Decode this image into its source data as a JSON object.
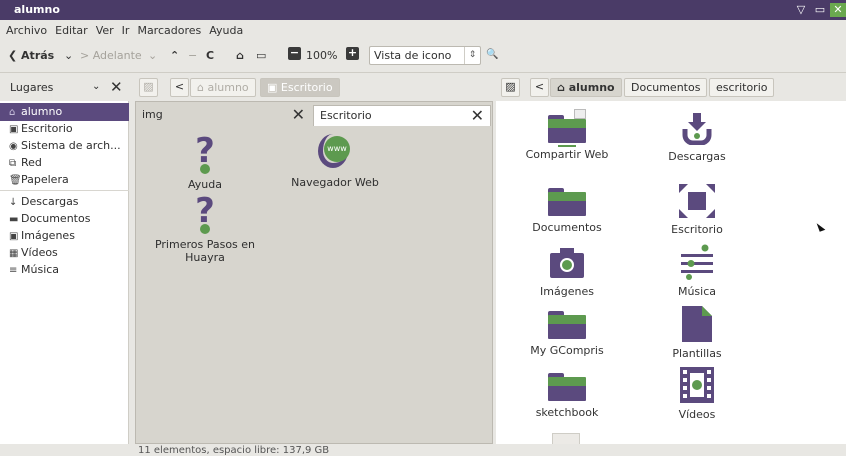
{
  "window": {
    "title": "alumno"
  },
  "menu": [
    "Archivo",
    "Editar",
    "Ver",
    "Ir",
    "Marcadores",
    "Ayuda"
  ],
  "toolbar": {
    "back": "❮ Atrás",
    "back_arrow": "⌄",
    "forward": "> Adelante",
    "forward_arrow": "⌄",
    "up": "⌃",
    "down": "−",
    "reload": "C",
    "home": "⌂",
    "computer": "▭",
    "zoom_out": "−",
    "zoom_level": "100%",
    "zoom_in": "+",
    "view_mode": "Vista de icono",
    "view_arrows": "⇕",
    "search": "🔍"
  },
  "sidebar": {
    "header": "Lugares",
    "header_chevron": "⌄",
    "close": "✕",
    "items": [
      {
        "label": "alumno",
        "icon": "⌂"
      },
      {
        "label": "Escritorio",
        "icon": "▣"
      },
      {
        "label": "Sistema de arch...",
        "icon": "◉"
      },
      {
        "label": "Red",
        "icon": "⧉"
      },
      {
        "label": "Papelera",
        "icon": "🗑"
      },
      {
        "label": "Descargas",
        "icon": "↓"
      },
      {
        "label": "Documentos",
        "icon": "▬"
      },
      {
        "label": "Imágenes",
        "icon": "▣"
      },
      {
        "label": "Vídeos",
        "icon": "▦"
      },
      {
        "label": "Música",
        "icon": "≡"
      }
    ]
  },
  "left_pane": {
    "path": {
      "toggle": "▨",
      "back": "<",
      "home_crumb": "⌂ alumno",
      "current": "▣ Escritorio"
    },
    "tabs": [
      {
        "label": "img",
        "close": "✕"
      },
      {
        "label": "Escritorio",
        "close": "✕"
      }
    ],
    "items": [
      {
        "label": "Ayuda",
        "icon": "?"
      },
      {
        "label": "Navegador Web",
        "icon": "www"
      },
      {
        "label": "Primeros Pasos en\nHuayra",
        "icon": "?"
      }
    ]
  },
  "right_pane": {
    "path": {
      "toggle": "▨",
      "back": "<",
      "home_crumb": "⌂ alumno",
      "c2": "Documentos",
      "c3": "escritorio"
    },
    "items": [
      {
        "label": "Compartir Web"
      },
      {
        "label": "Descargas"
      },
      {
        "label": "Documentos"
      },
      {
        "label": "Escritorio"
      },
      {
        "label": "Imágenes"
      },
      {
        "label": "Música"
      },
      {
        "label": "My GCompris"
      },
      {
        "label": "Plantillas"
      },
      {
        "label": "sketchbook"
      },
      {
        "label": "Vídeos"
      }
    ]
  },
  "statusbar": "11 elementos, espacio libre: 137,9 GB"
}
